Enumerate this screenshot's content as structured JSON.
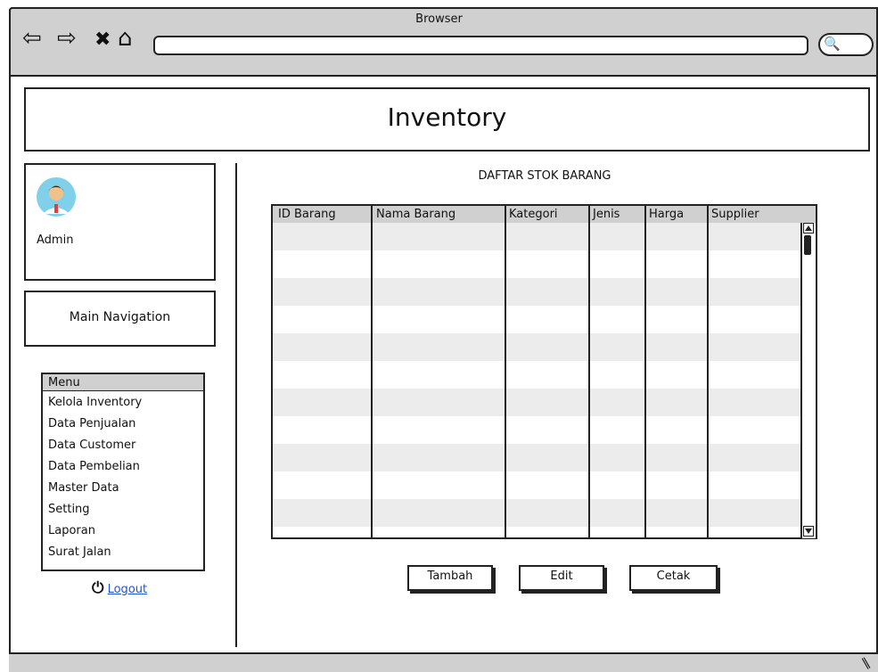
{
  "browser": {
    "title": "Browser",
    "address": ""
  },
  "header": {
    "title": "Inventory"
  },
  "profile": {
    "name": "Admin"
  },
  "navigation": {
    "label": "Main Navigation"
  },
  "menu": {
    "header": "Menu",
    "items": [
      "Kelola Inventory",
      "Data Penjualan",
      "Data Customer",
      "Data Pembelian",
      "Master Data",
      "Setting",
      "Laporan",
      "Surat Jalan"
    ]
  },
  "logout": {
    "icon": "power-icon",
    "label": "Logout"
  },
  "table": {
    "title": "DAFTAR STOK BARANG",
    "columns": [
      "ID Barang",
      "Nama Barang",
      "Kategori",
      "Jenis",
      "Harga",
      "Supplier"
    ],
    "rows": []
  },
  "actions": {
    "add": "Tambah",
    "edit": "Edit",
    "print": "Cetak"
  },
  "colors": {
    "chrome": "#d0d0d0",
    "stripe": "#ececec",
    "link": "#2255cc",
    "outline": "#222222"
  }
}
